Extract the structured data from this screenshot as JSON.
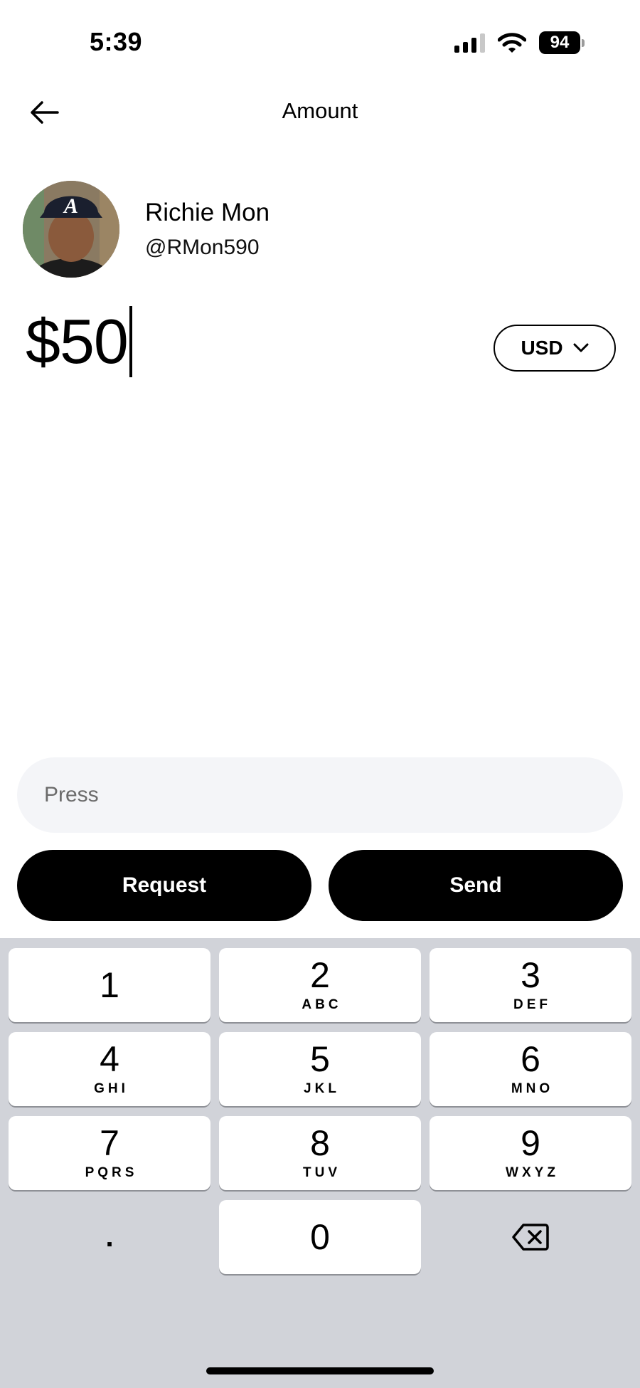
{
  "status_bar": {
    "time": "5:39",
    "battery": "94",
    "icons": [
      "cellular-signal-icon",
      "wifi-icon",
      "battery-icon"
    ]
  },
  "header": {
    "title": "Amount",
    "back_icon": "back-arrow-icon"
  },
  "recipient": {
    "name": "Richie Mon",
    "handle": "@RMon590"
  },
  "amount": {
    "value": "$50"
  },
  "currency": {
    "label": "USD",
    "icon": "chevron-down-icon"
  },
  "note": {
    "placeholder": "Press"
  },
  "actions": {
    "request_label": "Request",
    "send_label": "Send",
    "color": "#000000"
  },
  "keypad": {
    "keys": [
      {
        "digit": "1",
        "letters": ""
      },
      {
        "digit": "2",
        "letters": "ABC"
      },
      {
        "digit": "3",
        "letters": "DEF"
      },
      {
        "digit": "4",
        "letters": "GHI"
      },
      {
        "digit": "5",
        "letters": "JKL"
      },
      {
        "digit": "6",
        "letters": "MNO"
      },
      {
        "digit": "7",
        "letters": "PQRS"
      },
      {
        "digit": "8",
        "letters": "TUV"
      },
      {
        "digit": "9",
        "letters": "WXYZ"
      },
      {
        "digit": "0",
        "letters": ""
      }
    ],
    "decimal": ".",
    "delete_icon": "backspace-icon",
    "background": "#d1d3d9"
  }
}
